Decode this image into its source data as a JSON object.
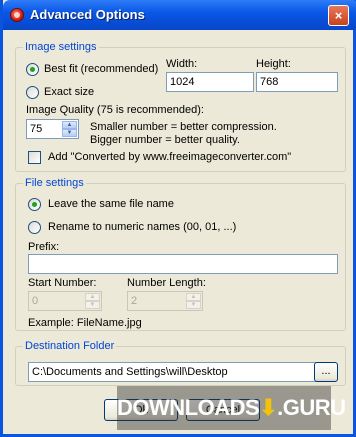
{
  "window": {
    "title": "Advanced Options",
    "close_glyph": "×"
  },
  "image_settings": {
    "group_title": "Image settings",
    "best_fit_label": "Best fit (recommended)",
    "best_fit_selected": true,
    "exact_size_label": "Exact size",
    "exact_size_selected": false,
    "width_label": "Width:",
    "width_value": "1024",
    "height_label": "Height:",
    "height_value": "768",
    "quality_label": "Image Quality (75 is recommended):",
    "quality_value": "75",
    "quality_hint_1": "Smaller number = better compression.",
    "quality_hint_2": "Bigger number = better quality.",
    "add_converted_label": "Add \"Converted by www.freeimageconverter.com\"",
    "add_converted_checked": false
  },
  "file_settings": {
    "group_title": "File settings",
    "leave_same_label": "Leave the same file name",
    "leave_same_selected": true,
    "rename_numeric_label": "Rename to numeric names (00, 01, ...)",
    "rename_numeric_selected": false,
    "prefix_label": "Prefix:",
    "prefix_value": "",
    "start_number_label": "Start Number:",
    "start_number_value": "0",
    "number_length_label": "Number Length:",
    "number_length_value": "2",
    "example_text": "Example: FileName.jpg"
  },
  "destination": {
    "group_title": "Destination Folder",
    "path_value": "C:\\Documents and Settings\\will\\Desktop",
    "browse_label": "..."
  },
  "buttons": {
    "ok_label": "Ok",
    "cancel_label": "Cancel"
  },
  "watermark": {
    "text_main": "DOWNLOADS",
    "text_accent": "⬇",
    "text_tail": ".GURU"
  },
  "icons": {
    "spin_up": "▲",
    "spin_down": "▼"
  },
  "colors": {
    "titlebar": "#0a58e6",
    "group_title": "#0046d5",
    "radio_dot": "#21a121"
  }
}
